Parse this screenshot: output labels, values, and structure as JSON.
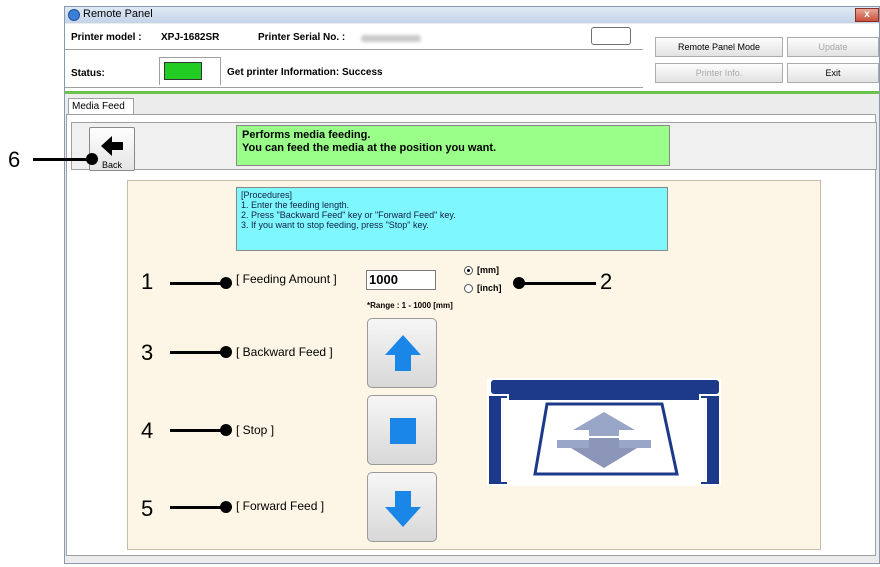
{
  "window": {
    "title": "Remote Panel",
    "close_label": "x"
  },
  "info": {
    "printer_model_label": "Printer model :",
    "printer_model_value": "XPJ-1682SR",
    "serial_label": "Printer Serial No. :",
    "status_label": "Status:",
    "status_message": "Get printer Information: Success",
    "status_color": "#22cc22"
  },
  "buttons": {
    "remote_panel_mode": "Remote Panel Mode",
    "update": "Update",
    "printer_info": "Printer Info.",
    "exit": "Exit"
  },
  "tab": {
    "label": "Media Feed"
  },
  "back": {
    "label": "Back"
  },
  "header_message": {
    "line1": "Performs media feeding.",
    "line2": "You can feed the media at the position you want."
  },
  "procedures": {
    "title": "[Procedures]",
    "steps": [
      "1. Enter the feeding length.",
      "2. Press \"Backward Feed\" key or \"Forward Feed\" key.",
      "3. If you want to stop feeding, press \"Stop\" key."
    ]
  },
  "feeding": {
    "label": "[ Feeding Amount ]",
    "value": "1000",
    "unit_mm": "[mm]",
    "unit_inch": "[inch]",
    "selected_unit": "mm",
    "range": "*Range : 1 - 1000 [mm]"
  },
  "controls": {
    "backward_label": "[ Backward Feed ]",
    "stop_label": "[ Stop ]",
    "forward_label": "[ Forward Feed ]"
  },
  "callouts": [
    "1",
    "2",
    "3",
    "4",
    "5",
    "6"
  ],
  "colors": {
    "accent_green": "#99ff88",
    "procedures_cyan": "#7ff7ff",
    "panel_beige": "#fdf5e6",
    "arrow_blue": "#1a86e8",
    "printer_navy": "#1d3a8a"
  }
}
